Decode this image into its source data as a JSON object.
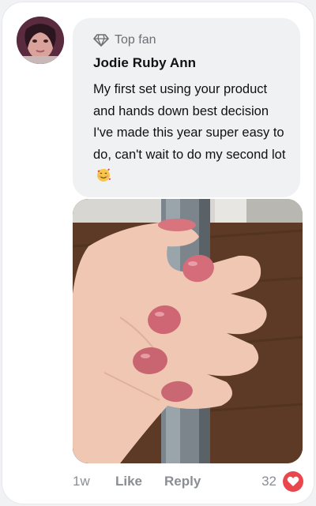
{
  "comment": {
    "badge_label": "Top fan",
    "badge_icon": "diamond-icon",
    "author": "Jodie Ruby Ann",
    "text": "My first set using your product and hands down best decision I've made this year super easy to do, can't wait to do my second lot",
    "emoji_icon": "smiling-face-with-hearts-icon"
  },
  "actions": {
    "time": "1w",
    "like_label": "Like",
    "reply_label": "Reply",
    "like_count": "32",
    "reaction_icon": "heart-icon"
  },
  "colors": {
    "bubble": "#f0f1f3",
    "heart": "#e8474e",
    "muted_text": "#8a8e94"
  }
}
